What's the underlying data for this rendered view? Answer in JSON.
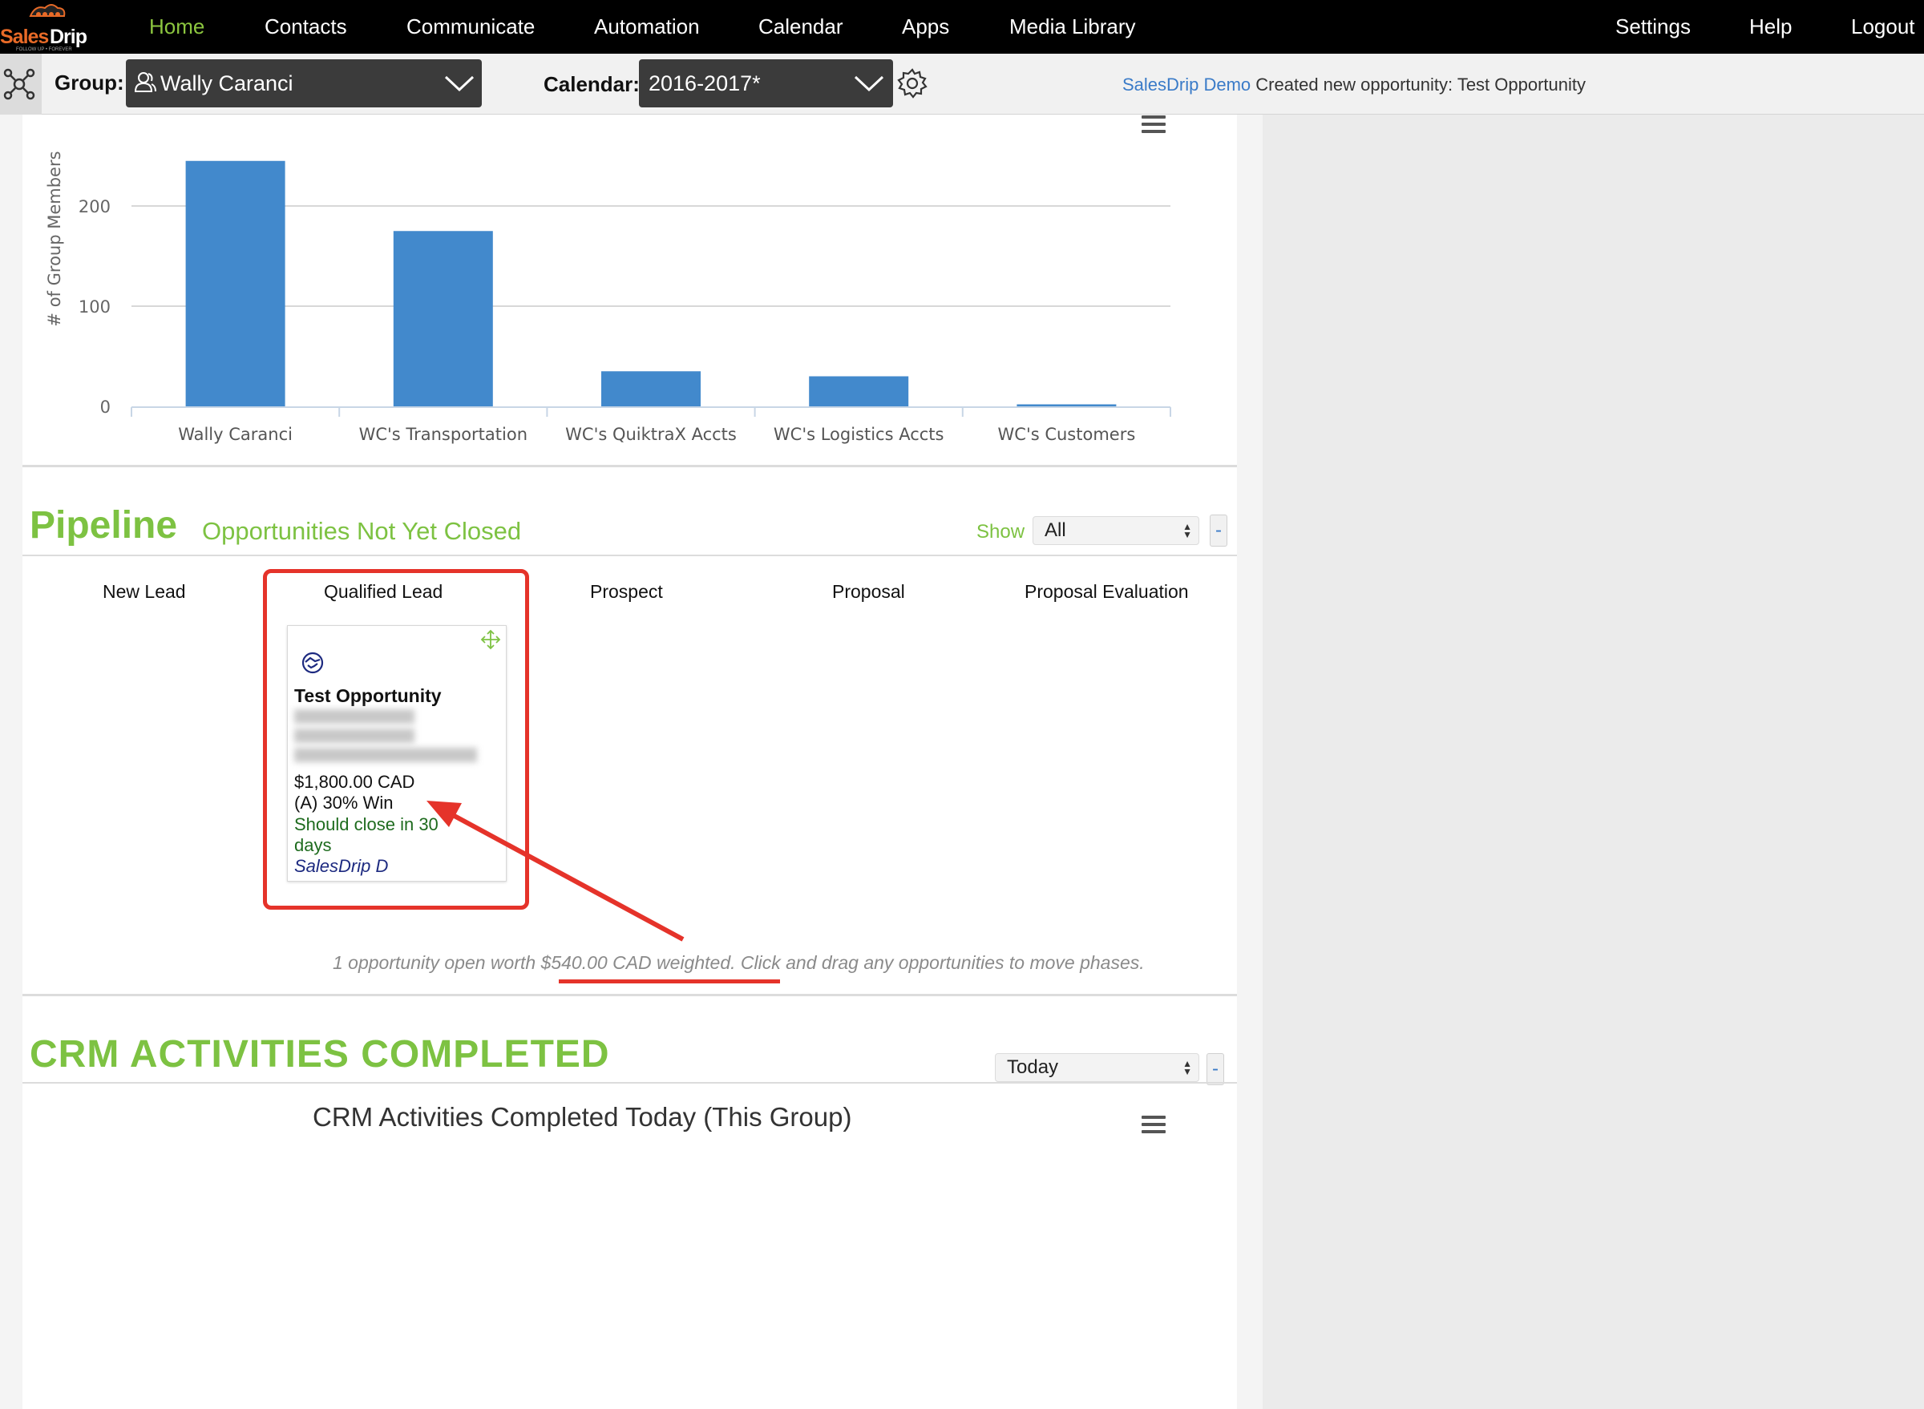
{
  "nav": {
    "logo_text": "SalesDrip",
    "logo_tagline": "FOLLOW UP • FOREVER",
    "items": [
      "Home",
      "Contacts",
      "Communicate",
      "Automation",
      "Calendar",
      "Apps",
      "Media Library"
    ],
    "right_items": [
      "Settings",
      "Help",
      "Logout"
    ]
  },
  "toolbar": {
    "group_label": "Group:",
    "group_value": "Wally Caranci",
    "calendar_label": "Calendar:",
    "calendar_value": "2016-2017*",
    "notice_user": "SalesDrip Demo",
    "notice_text": " Created new opportunity: Test Opportunity"
  },
  "chart_data": {
    "type": "bar",
    "categories": [
      "Wally Caranci",
      "WC's Transportation",
      "WC's QuiktraX Accts",
      "WC's Logistics Accts",
      "WC's Customers"
    ],
    "values": [
      245,
      175,
      35,
      30,
      2
    ],
    "title": "",
    "xlabel": "",
    "ylabel": "# of Group Members",
    "ylim": [
      0,
      245
    ],
    "yticks": [
      0,
      100,
      200
    ],
    "grid": true,
    "color": "#4289cc"
  },
  "pipeline": {
    "title": "Pipeline",
    "subtitle": "Opportunities Not Yet Closed",
    "show_label": "Show",
    "show_value": "All",
    "collapse_label": "-",
    "phases": [
      "New Lead",
      "Qualified Lead",
      "Prospect",
      "Proposal",
      "Proposal Evaluation"
    ],
    "card": {
      "title": "Test Opportunity",
      "amount": "$1,800.00 CAD",
      "probability": "(A) 30% Win",
      "close_line1": "Should close in 30",
      "close_line2": "days",
      "owner": "SalesDrip D"
    },
    "summary_prefix": "1 opportunity open worth ",
    "summary_amount": "$540.00 CAD weighted",
    "summary_suffix": ". Click and drag any opportunities to move phases."
  },
  "crm": {
    "title": "CRM ACTIVITIES COMPLETED",
    "range_value": "Today",
    "collapse_label": "-",
    "chart_title": "CRM Activities Completed Today (This Group)"
  },
  "colors": {
    "brand_green": "#7dc242",
    "bar_blue": "#4289cc",
    "annotation_red": "#e5332a",
    "nav_active": "#8cc63f"
  }
}
